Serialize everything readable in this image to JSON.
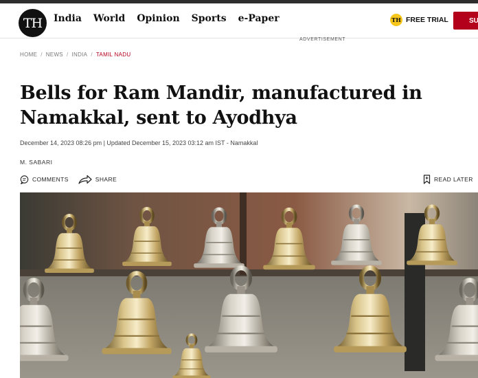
{
  "header": {
    "logo_text": "TH",
    "nav": [
      "India",
      "World",
      "Opinion",
      "Sports",
      "e-Paper"
    ],
    "trial_badge": "TH",
    "trial_label": "FREE TRIAL",
    "subscribe_label": "SU"
  },
  "advertisement_label": "ADVERTISEMENT",
  "breadcrumb": [
    "HOME",
    "NEWS",
    "INDIA",
    "TAMIL NADU"
  ],
  "article": {
    "headline_line1": "Bells for Ram Mandir, manufactured in",
    "headline_line2": "Namakkal, sent to Ayodhya",
    "meta": "December 14, 2023 08:26 pm | Updated December 15, 2023 03:12 am IST - Namakkal",
    "author": "M. SABARI",
    "comments_label": "COMMENTS",
    "share_label": "SHARE",
    "read_later_label": "READ LATER"
  },
  "colors": {
    "brand_red": "#b3001b",
    "badge_yellow": "#f7c61b",
    "topbar": "#2e2e2e"
  },
  "icons": [
    "comment-icon",
    "share-icon",
    "bookmark-icon"
  ]
}
